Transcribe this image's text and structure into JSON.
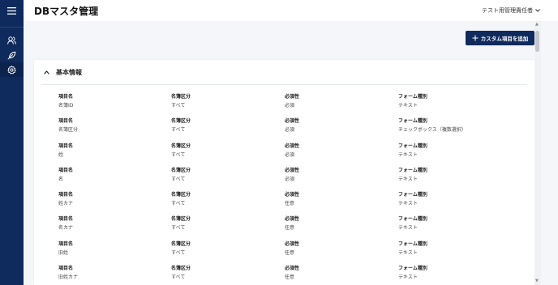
{
  "header": {
    "title": "DBマスタ管理",
    "user": "テスト用管理責任者"
  },
  "toolbar": {
    "add_label": "カスタム項目を追加"
  },
  "section": {
    "title": "基本情報"
  },
  "columns": {
    "item": "項目名",
    "category": "名簿区分",
    "required": "必須性",
    "form_type": "フォーム種別"
  },
  "rows": [
    {
      "item": "名簿ID",
      "category": "すべて",
      "required": "必須",
      "form_type": "テキスト"
    },
    {
      "item": "名簿区分",
      "category": "すべて",
      "required": "必須",
      "form_type": "チェックボックス（複数選択）"
    },
    {
      "item": "姓",
      "category": "すべて",
      "required": "必須",
      "form_type": "テキスト"
    },
    {
      "item": "名",
      "category": "すべて",
      "required": "必須",
      "form_type": "テキスト"
    },
    {
      "item": "姓カナ",
      "category": "すべて",
      "required": "任意",
      "form_type": "テキスト"
    },
    {
      "item": "名カナ",
      "category": "すべて",
      "required": "任意",
      "form_type": "テキスト"
    },
    {
      "item": "旧姓",
      "category": "すべて",
      "required": "任意",
      "form_type": "テキスト"
    },
    {
      "item": "旧姓カナ",
      "category": "すべて",
      "required": "任意",
      "form_type": "テキスト"
    }
  ],
  "colors": {
    "navy": "#0f2a5c",
    "background": "#f4f6fa"
  },
  "icons": {
    "menu": "hamburger-icon",
    "users": "users-icon",
    "feather": "feather-icon",
    "settings": "gear-icon"
  }
}
